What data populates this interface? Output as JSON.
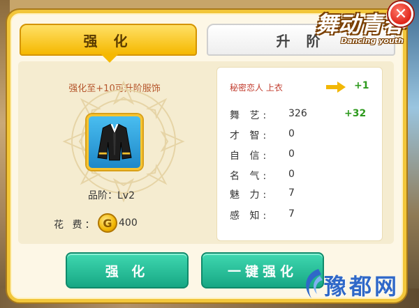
{
  "tabs": [
    {
      "label": "强 化",
      "active": true
    },
    {
      "label": "升 阶",
      "active": false
    }
  ],
  "hint": "强化至+10可升阶服饰",
  "item": {
    "icon": "black-jacket-icon",
    "grade": "品阶：Lv2",
    "name": "秘密恋人 上衣",
    "bonus": "+1"
  },
  "cost": {
    "label": "花 费：",
    "value": "400",
    "coin_glyph": "G"
  },
  "stats": [
    {
      "label": "舞 艺:",
      "value": "326",
      "bonus": "+32"
    },
    {
      "label": "才 智:",
      "value": "0",
      "bonus": ""
    },
    {
      "label": "自 信:",
      "value": "0",
      "bonus": ""
    },
    {
      "label": "名 气:",
      "value": "0",
      "bonus": ""
    },
    {
      "label": "魅 力:",
      "value": "7",
      "bonus": ""
    },
    {
      "label": "感 知:",
      "value": "7",
      "bonus": ""
    }
  ],
  "buttons": {
    "enhance": "强 化",
    "one_key_enhance": "一键强化"
  },
  "logo": {
    "title": "舞动青春",
    "subtitle": "Dancing youth"
  },
  "watermark": "豫都网",
  "colors": {
    "panel_border": "#f2c63a",
    "active_tab": "#f5b800",
    "button": "#17a784",
    "bonus_green": "#2e9a1e",
    "item_name_red": "#c0392b"
  }
}
